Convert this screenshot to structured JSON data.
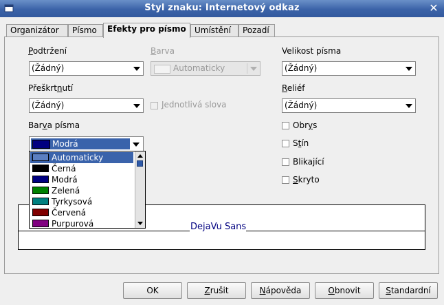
{
  "window": {
    "title": "Styl znaku: Internetový odkaz"
  },
  "tabs": [
    {
      "label": "Organizátor"
    },
    {
      "label": "Písmo"
    },
    {
      "label": "Efekty pro písmo",
      "active": true
    },
    {
      "label": "Umístění"
    },
    {
      "label": "Pozadí"
    }
  ],
  "effects": {
    "underline": {
      "label": "Podtržení",
      "value": "(Žádný)"
    },
    "color": {
      "label": "Barva",
      "value": "Automaticky"
    },
    "fontsize": {
      "label": "Velikost písma",
      "value": "(Žádný)"
    },
    "strikeout": {
      "label": "Přeškrtnutí",
      "value": "(Žádný)"
    },
    "individual_words": {
      "label": "Jednotlivá slova",
      "checked": false
    },
    "relief": {
      "label": "Reliéf",
      "value": "(Žádný)"
    },
    "font_color": {
      "label": "Barva písma",
      "value": "Modrá",
      "swatch": "#000080"
    },
    "checkboxes": {
      "outline": "Obrys",
      "shadow": "Stín",
      "blinking": "Blikající",
      "hidden": "Skryto"
    }
  },
  "font_color_options": [
    {
      "label": "Automaticky",
      "color": "#5b7fc2"
    },
    {
      "label": "Černá",
      "color": "#000000"
    },
    {
      "label": "Modrá",
      "color": "#000080"
    },
    {
      "label": "Zelená",
      "color": "#008000"
    },
    {
      "label": "Tyrkysová",
      "color": "#008080"
    },
    {
      "label": "Červená",
      "color": "#800000"
    },
    {
      "label": "Purpurová",
      "color": "#800080"
    }
  ],
  "preview": {
    "text": "DejaVu Sans"
  },
  "buttons": {
    "ok": "OK",
    "cancel": "Zrušit",
    "help": "Nápověda",
    "reset": "Obnovit",
    "standard": "Standardní"
  }
}
